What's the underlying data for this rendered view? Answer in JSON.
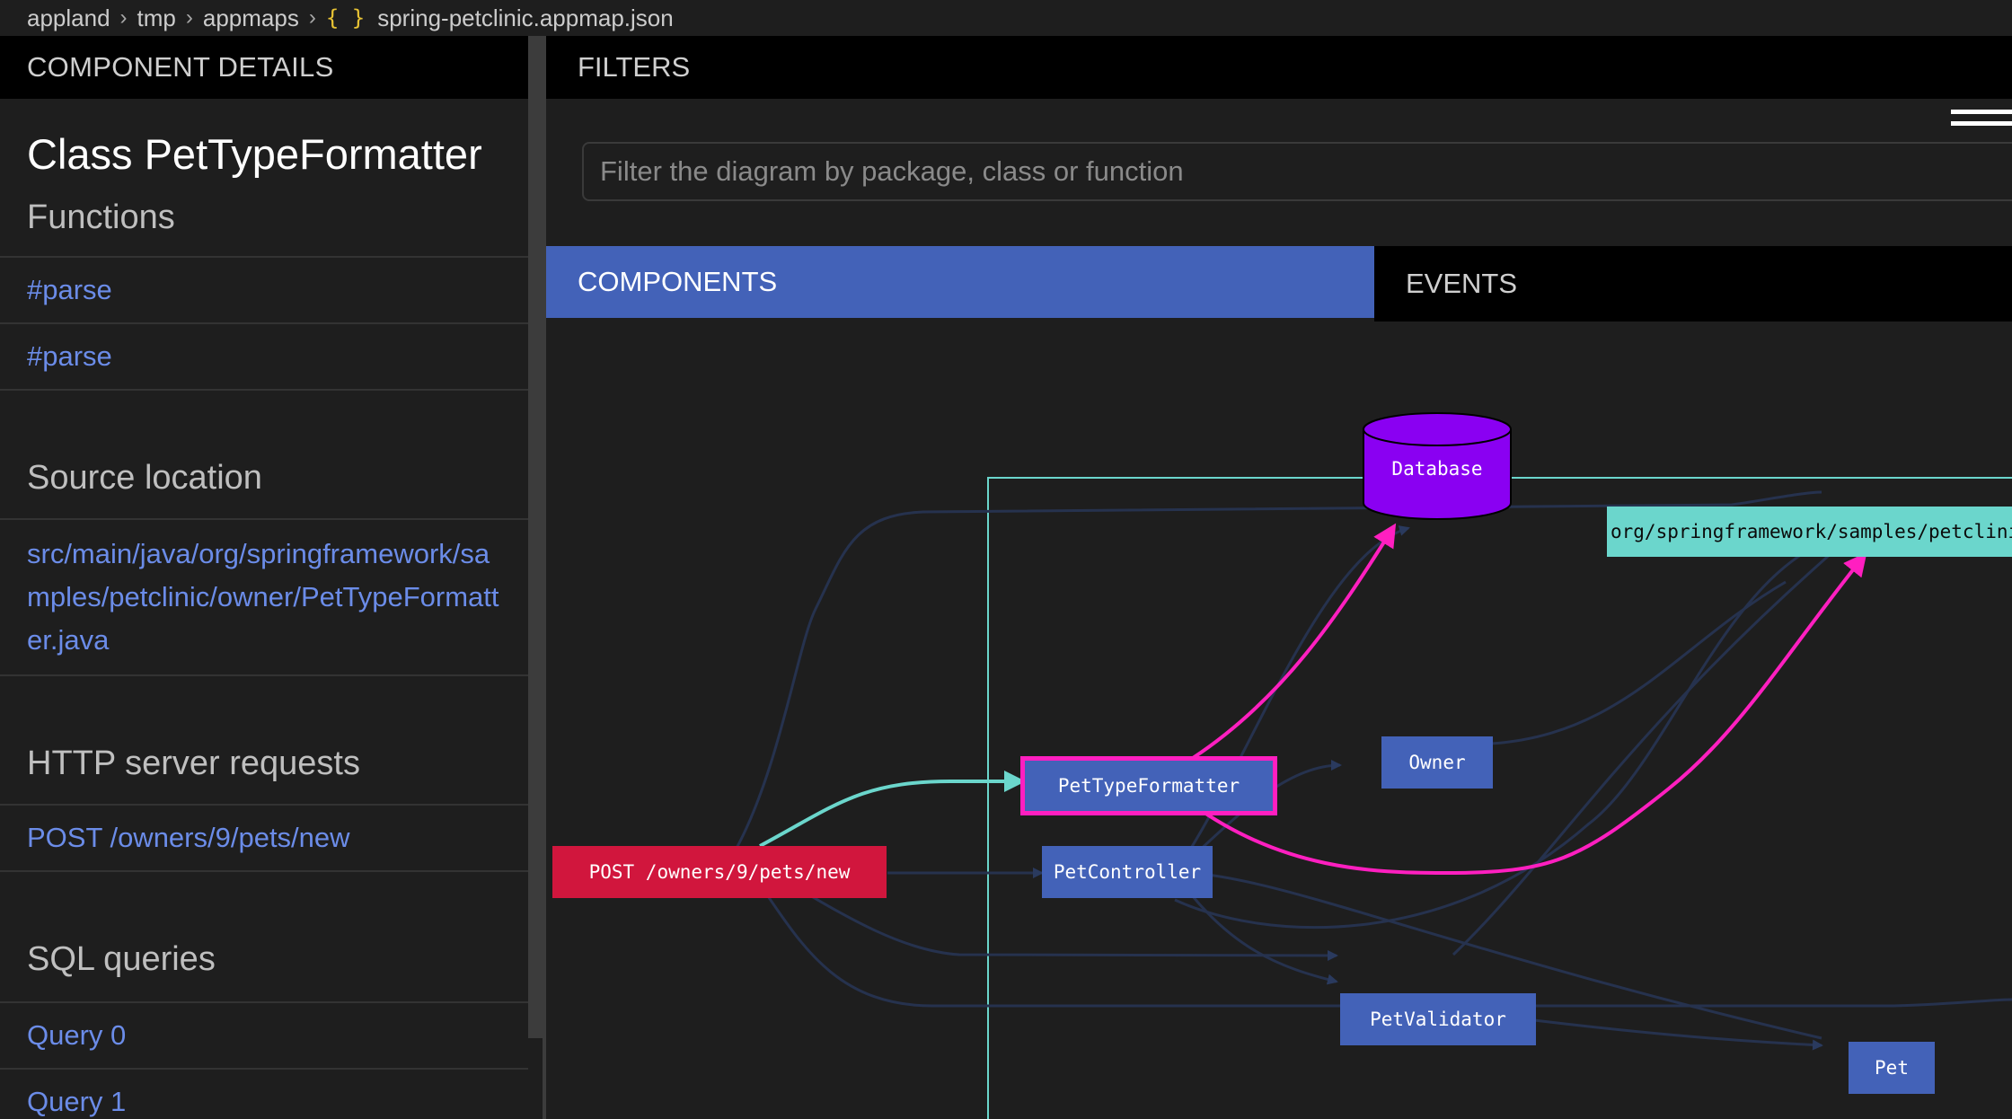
{
  "breadcrumb": {
    "parts": [
      "appland",
      "tmp",
      "appmaps"
    ],
    "file": "spring-petclinic.appmap.json",
    "file_icon": "{ }"
  },
  "left": {
    "header": "COMPONENT DETAILS",
    "class_title": "Class PetTypeFormatter",
    "functions_title": "Functions",
    "functions": [
      "#parse",
      "#parse"
    ],
    "source_title": "Source location",
    "source_path": "src/main/java/org/springframework/samples/petclinic/owner/PetTypeFormatter.java",
    "http_title": "HTTP server requests",
    "http_requests": [
      "POST /owners/9/pets/new"
    ],
    "sql_title": "SQL queries",
    "sql_queries": [
      "Query 0",
      "Query 1"
    ]
  },
  "right": {
    "header": "FILTERS",
    "filter_placeholder": "Filter the diagram by package, class or function",
    "tabs": {
      "components": "COMPONENTS",
      "events": "EVENTS"
    }
  },
  "diagram": {
    "database": "Database",
    "package": "org/springframework/samples/petclinic",
    "http_node": "POST /owners/9/pets/new",
    "classes": {
      "pet_type_formatter": "PetTypeFormatter",
      "owner": "Owner",
      "pet_controller": "PetController",
      "pet_validator": "PetValidator",
      "pet": "Pet"
    },
    "colors": {
      "class": "#4362b8",
      "http": "#d1163d",
      "database": "#8a00f2",
      "package": "#6bd6cc",
      "highlight": "#ff1fc0",
      "incoming": "#6bd6cc"
    }
  }
}
